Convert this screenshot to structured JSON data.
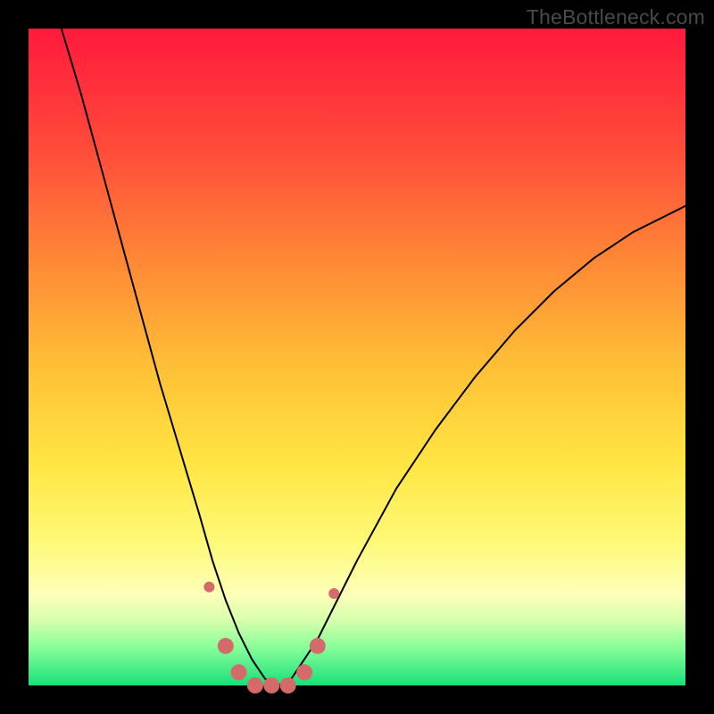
{
  "watermark": "TheBottleneck.com",
  "chart_data": {
    "type": "line",
    "title": "",
    "xlabel": "",
    "ylabel": "",
    "xlim": [
      0,
      100
    ],
    "ylim": [
      0,
      100
    ],
    "grid": false,
    "legend": false,
    "background_gradient": {
      "direction": "vertical",
      "stops": [
        {
          "pos": 0.0,
          "color": "#ff1a3c"
        },
        {
          "pos": 0.5,
          "color": "#ffc136"
        },
        {
          "pos": 0.8,
          "color": "#fff976"
        },
        {
          "pos": 1.0,
          "color": "#18e07a"
        }
      ]
    },
    "series": [
      {
        "name": "bottleneck-curve",
        "color": "#000000",
        "stroke_width": 2,
        "x": [
          5,
          8,
          11,
          14,
          17,
          20,
          23,
          26,
          28,
          30,
          32,
          34,
          36,
          38,
          40,
          44,
          50,
          56,
          62,
          68,
          74,
          80,
          86,
          92,
          98,
          100
        ],
        "y": [
          100,
          90,
          79,
          68,
          57,
          46,
          36,
          26,
          19,
          13,
          8,
          4,
          1,
          0,
          1,
          7,
          19,
          30,
          39,
          47,
          54,
          60,
          65,
          69,
          72,
          73
        ]
      }
    ],
    "markers": {
      "name": "highlight-dots",
      "color": "#d46a6a",
      "radius_small": 6,
      "radius_large": 9,
      "points": [
        {
          "x": 27.5,
          "y": 15,
          "r": "small"
        },
        {
          "x": 30.0,
          "y": 6,
          "r": "large"
        },
        {
          "x": 32.0,
          "y": 2,
          "r": "large"
        },
        {
          "x": 34.5,
          "y": 0,
          "r": "large"
        },
        {
          "x": 37.0,
          "y": 0,
          "r": "large"
        },
        {
          "x": 39.5,
          "y": 0,
          "r": "large"
        },
        {
          "x": 42.0,
          "y": 2,
          "r": "large"
        },
        {
          "x": 44.0,
          "y": 6,
          "r": "large"
        },
        {
          "x": 46.5,
          "y": 14,
          "r": "small"
        }
      ]
    }
  }
}
